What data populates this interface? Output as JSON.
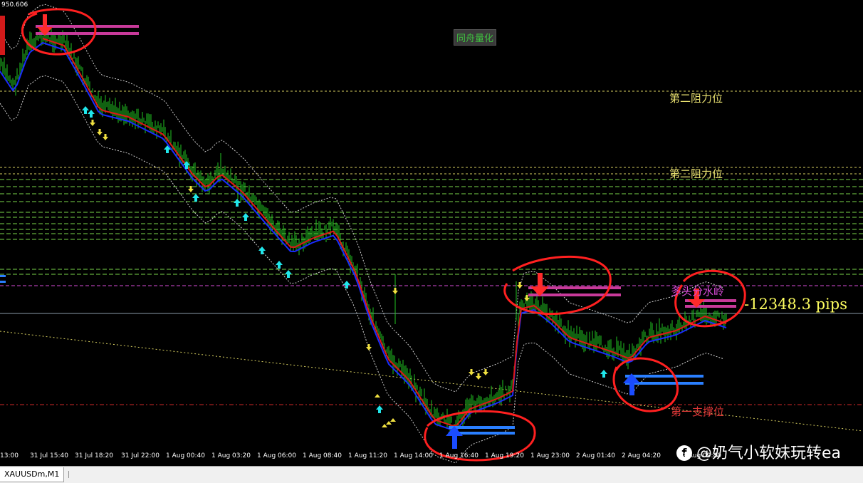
{
  "chart": {
    "symbol_tab": "XAUUSDm,M1",
    "price_top": "950.606",
    "indicator_name": "同舟量化",
    "levels": {
      "resistance_2a": "第二阻力位",
      "resistance_2b": "第二阻力位",
      "bull_line": "多头分水岭",
      "support_1": "第一支撑位"
    },
    "pips": "-12348.3 pips",
    "watermark": "@奶气小软妹玩转ea",
    "time_ticks": [
      "13:00",
      "31 Jul 15:40",
      "31 Jul 18:20",
      "31 Jul 22:00",
      "1 Aug 00:40",
      "1 Aug 03:20",
      "1 Aug 06:00",
      "1 Aug 08:40",
      "1 Aug 11:20",
      "1 Aug 14:00",
      "1 Aug 16:40",
      "1 Aug 19:20",
      "1 Aug 23:00",
      "2 Aug 01:40",
      "2 Aug 04:20",
      "2 Aug 09:40"
    ],
    "colors": {
      "background": "#000000",
      "price": "#22c322",
      "ma_fast": "#e01818",
      "ma_slow": "#1a2cff",
      "resistance": "#e8e070",
      "green_levels": "#7ad64a",
      "bull_line": "#d84bd8",
      "support": "#e03838",
      "buy_arrow": "#20e6ea",
      "sell_arrow": "#f0e040",
      "annotation_circle": "#ff2020"
    }
  }
}
